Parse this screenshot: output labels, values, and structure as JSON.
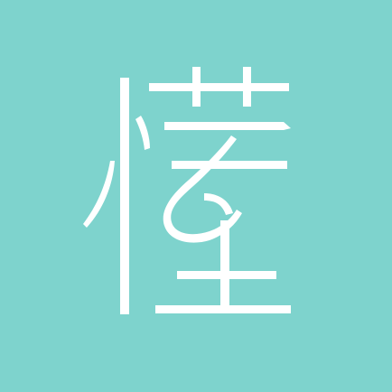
{
  "logo": {
    "glyph": "懂",
    "icon": "dong-character-logo-icon",
    "background_color": "#7ed3cd",
    "glyph_color": "#ffffff"
  }
}
